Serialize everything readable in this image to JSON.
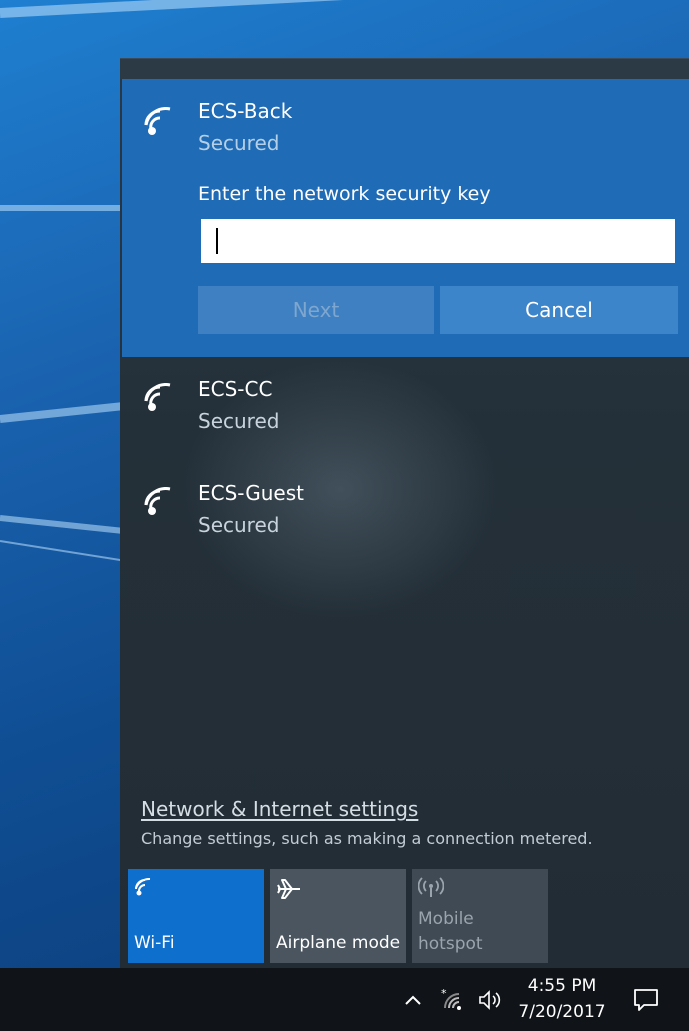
{
  "networks": [
    {
      "name": "ECS-Back",
      "status": "Secured",
      "icon": "wifi-icon"
    },
    {
      "name": "ECS-CC",
      "status": "Secured",
      "icon": "wifi-icon"
    },
    {
      "name": "ECS-Guest",
      "status": "Secured",
      "icon": "wifi-icon"
    }
  ],
  "connect": {
    "prompt": "Enter the network security key",
    "key_value": "",
    "next_label": "Next",
    "cancel_label": "Cancel"
  },
  "settings": {
    "link_text": "Network & Internet settings",
    "description": "Change settings, such as making a connection metered."
  },
  "quick_actions": [
    {
      "label": "Wi-Fi",
      "state": "on",
      "icon": "wifi-icon"
    },
    {
      "label": "Airplane mode",
      "state": "off",
      "icon": "airplane-icon"
    },
    {
      "label_line1": "Mobile",
      "label_line2": "hotspot",
      "state": "disabled",
      "icon": "hotspot-icon"
    }
  ],
  "taskbar": {
    "time": "4:55 PM",
    "date": "7/20/2017",
    "tray_icons": [
      "chevron-up-icon",
      "network-icon",
      "volume-icon",
      "action-center-icon"
    ]
  },
  "colors": {
    "accent": "#1f6bb5",
    "wifi_tile": "#0f6fcc",
    "flyout_bg": "#243039",
    "taskbar_bg": "#101418"
  }
}
